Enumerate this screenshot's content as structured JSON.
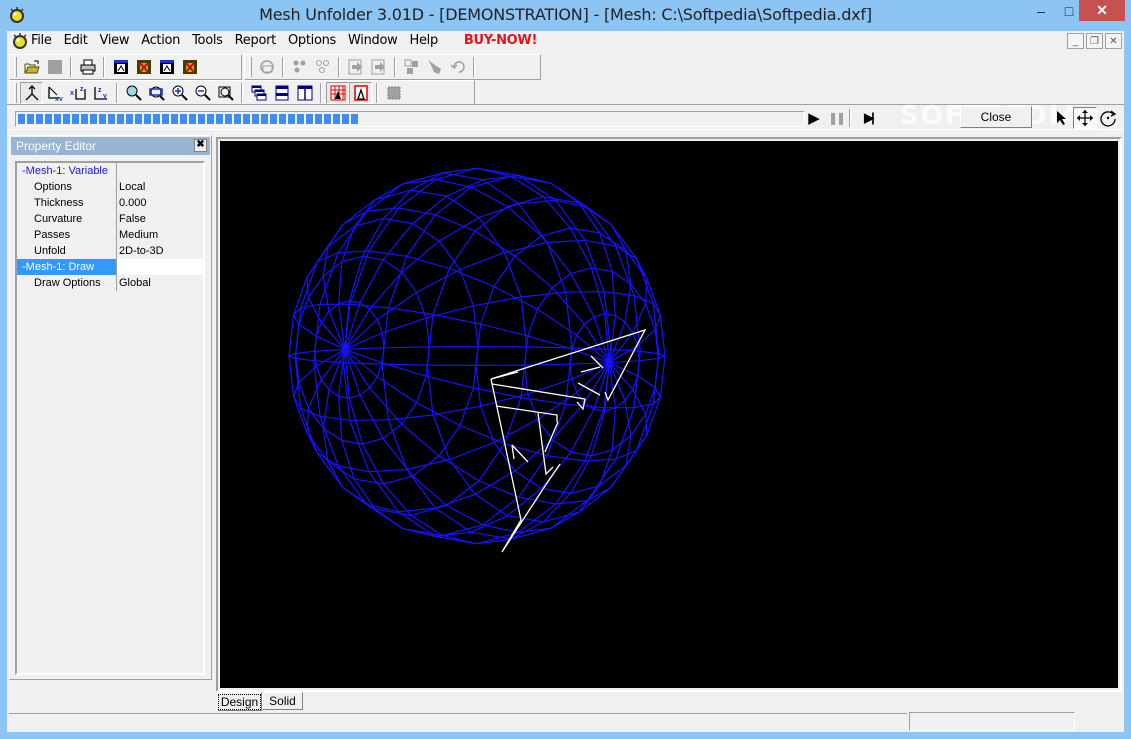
{
  "window": {
    "title": "Mesh Unfolder 3.01D - [DEMONSTRATION] - [Mesh: C:\\Softpedia\\Softpedia.dxf]",
    "minimize_glyph": "–",
    "maximize_glyph": "□",
    "close_glyph": "✕"
  },
  "menubar": {
    "items": [
      "File",
      "Edit",
      "View",
      "Action",
      "Tools",
      "Report",
      "Options",
      "Window",
      "Help"
    ],
    "buy_label": "BUY-NOW!",
    "mdi_minimize": "_",
    "mdi_restore": "❐",
    "mdi_close": "✕"
  },
  "toolbar1": {
    "buttons": [
      "open-icon",
      "save-icon",
      "print-icon",
      "export-dxf-icon",
      "export-dxf-x-icon",
      "export-bmp-icon",
      "export-bmp-x-icon",
      "unfold-icon",
      "select-faces-icon",
      "deselect-faces-icon",
      "move-in-icon",
      "move-out-icon",
      "split-icon",
      "pointer-delete-icon",
      "undo-icon"
    ]
  },
  "toolbar2": {
    "buttons": [
      "view-3d-icon",
      "view-xy-icon",
      "view-xz-icon",
      "view-zy-icon",
      "zoom-icon",
      "zoom-window-icon",
      "zoom-in-icon",
      "zoom-out-icon",
      "zoom-extents-icon",
      "cascade-icon",
      "tile-horizontal-icon",
      "tile-vertical-icon",
      "grid-draw-icon",
      "page-draw-icon",
      "selection-area-icon"
    ]
  },
  "progress": {
    "fraction": 0.46,
    "blocks_filled": 38
  },
  "controls": {
    "play_glyph": "▶",
    "pause_glyph": "❚❚",
    "step_glyph": "▶|",
    "close_label": "Close",
    "watermark": "SOFTPEDIA"
  },
  "property_editor": {
    "title": "Property Editor",
    "close_glyph": "✖",
    "rows": [
      {
        "key": "-Mesh-1: Variable",
        "value": "",
        "group": true,
        "selected": false
      },
      {
        "key": "Options",
        "value": "Local"
      },
      {
        "key": "Thickness",
        "value": "0.000"
      },
      {
        "key": "Curvature",
        "value": "False"
      },
      {
        "key": "Passes",
        "value": "Medium"
      },
      {
        "key": "Unfold",
        "value": "2D-to-3D"
      },
      {
        "key": "-Mesh-1: Draw",
        "value": "",
        "group": true,
        "selected": true
      },
      {
        "key": "Draw Options",
        "value": "Global"
      }
    ]
  },
  "viewport": {
    "mesh_color": "#1414ff",
    "unfold_color": "#ffffff",
    "background": "#000000"
  },
  "tabs": [
    {
      "label": "Design",
      "active": true
    },
    {
      "label": "Solid",
      "active": false
    }
  ],
  "statusbar": {
    "main_text": "",
    "right_text": ""
  }
}
